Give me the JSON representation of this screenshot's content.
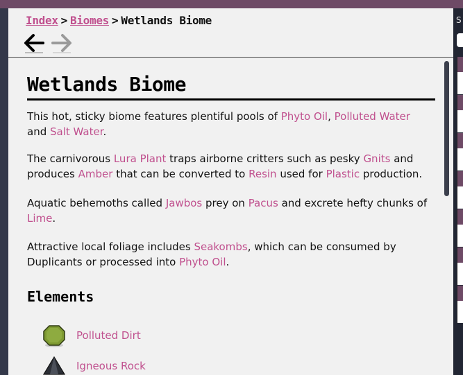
{
  "breadcrumb": {
    "items": [
      "Index",
      "Biomes"
    ],
    "separator": ">",
    "current": "Wetlands Biome"
  },
  "title": "Wetlands Biome",
  "paragraphs": {
    "p1": [
      "This hot, sticky biome features plentiful pools of ",
      "Phyto Oil",
      ", ",
      "Polluted Water",
      " and ",
      "Salt Water",
      "."
    ],
    "p2": [
      "The carnivorous ",
      "Lura Plant",
      " traps airborne critters such as pesky ",
      "Gnits",
      " and produces ",
      "Amber",
      " that can be converted to ",
      "Resin",
      " used for ",
      "Plastic",
      " production."
    ],
    "p3": [
      "Aquatic behemoths called ",
      "Jawbos",
      " prey on ",
      "Pacus",
      " and excrete hefty chunks of ",
      "Lime",
      "."
    ],
    "p4": [
      "Attractive local foliage includes ",
      "Seakombs",
      ", which can be consumed by Duplicants or processed into ",
      "Phyto Oil",
      "."
    ]
  },
  "elements_heading": "Elements",
  "elements": [
    {
      "name": "Polluted Dirt",
      "icon": "polluted-dirt-icon"
    },
    {
      "name": "Igneous Rock",
      "icon": "igneous-rock-icon"
    }
  ],
  "right_panel": {
    "search_label": "S"
  },
  "colors": {
    "link": "#c0508e",
    "accent": "#6e4a66",
    "panel_bg": "#f1f1f1",
    "background": "#3a3f4e"
  }
}
